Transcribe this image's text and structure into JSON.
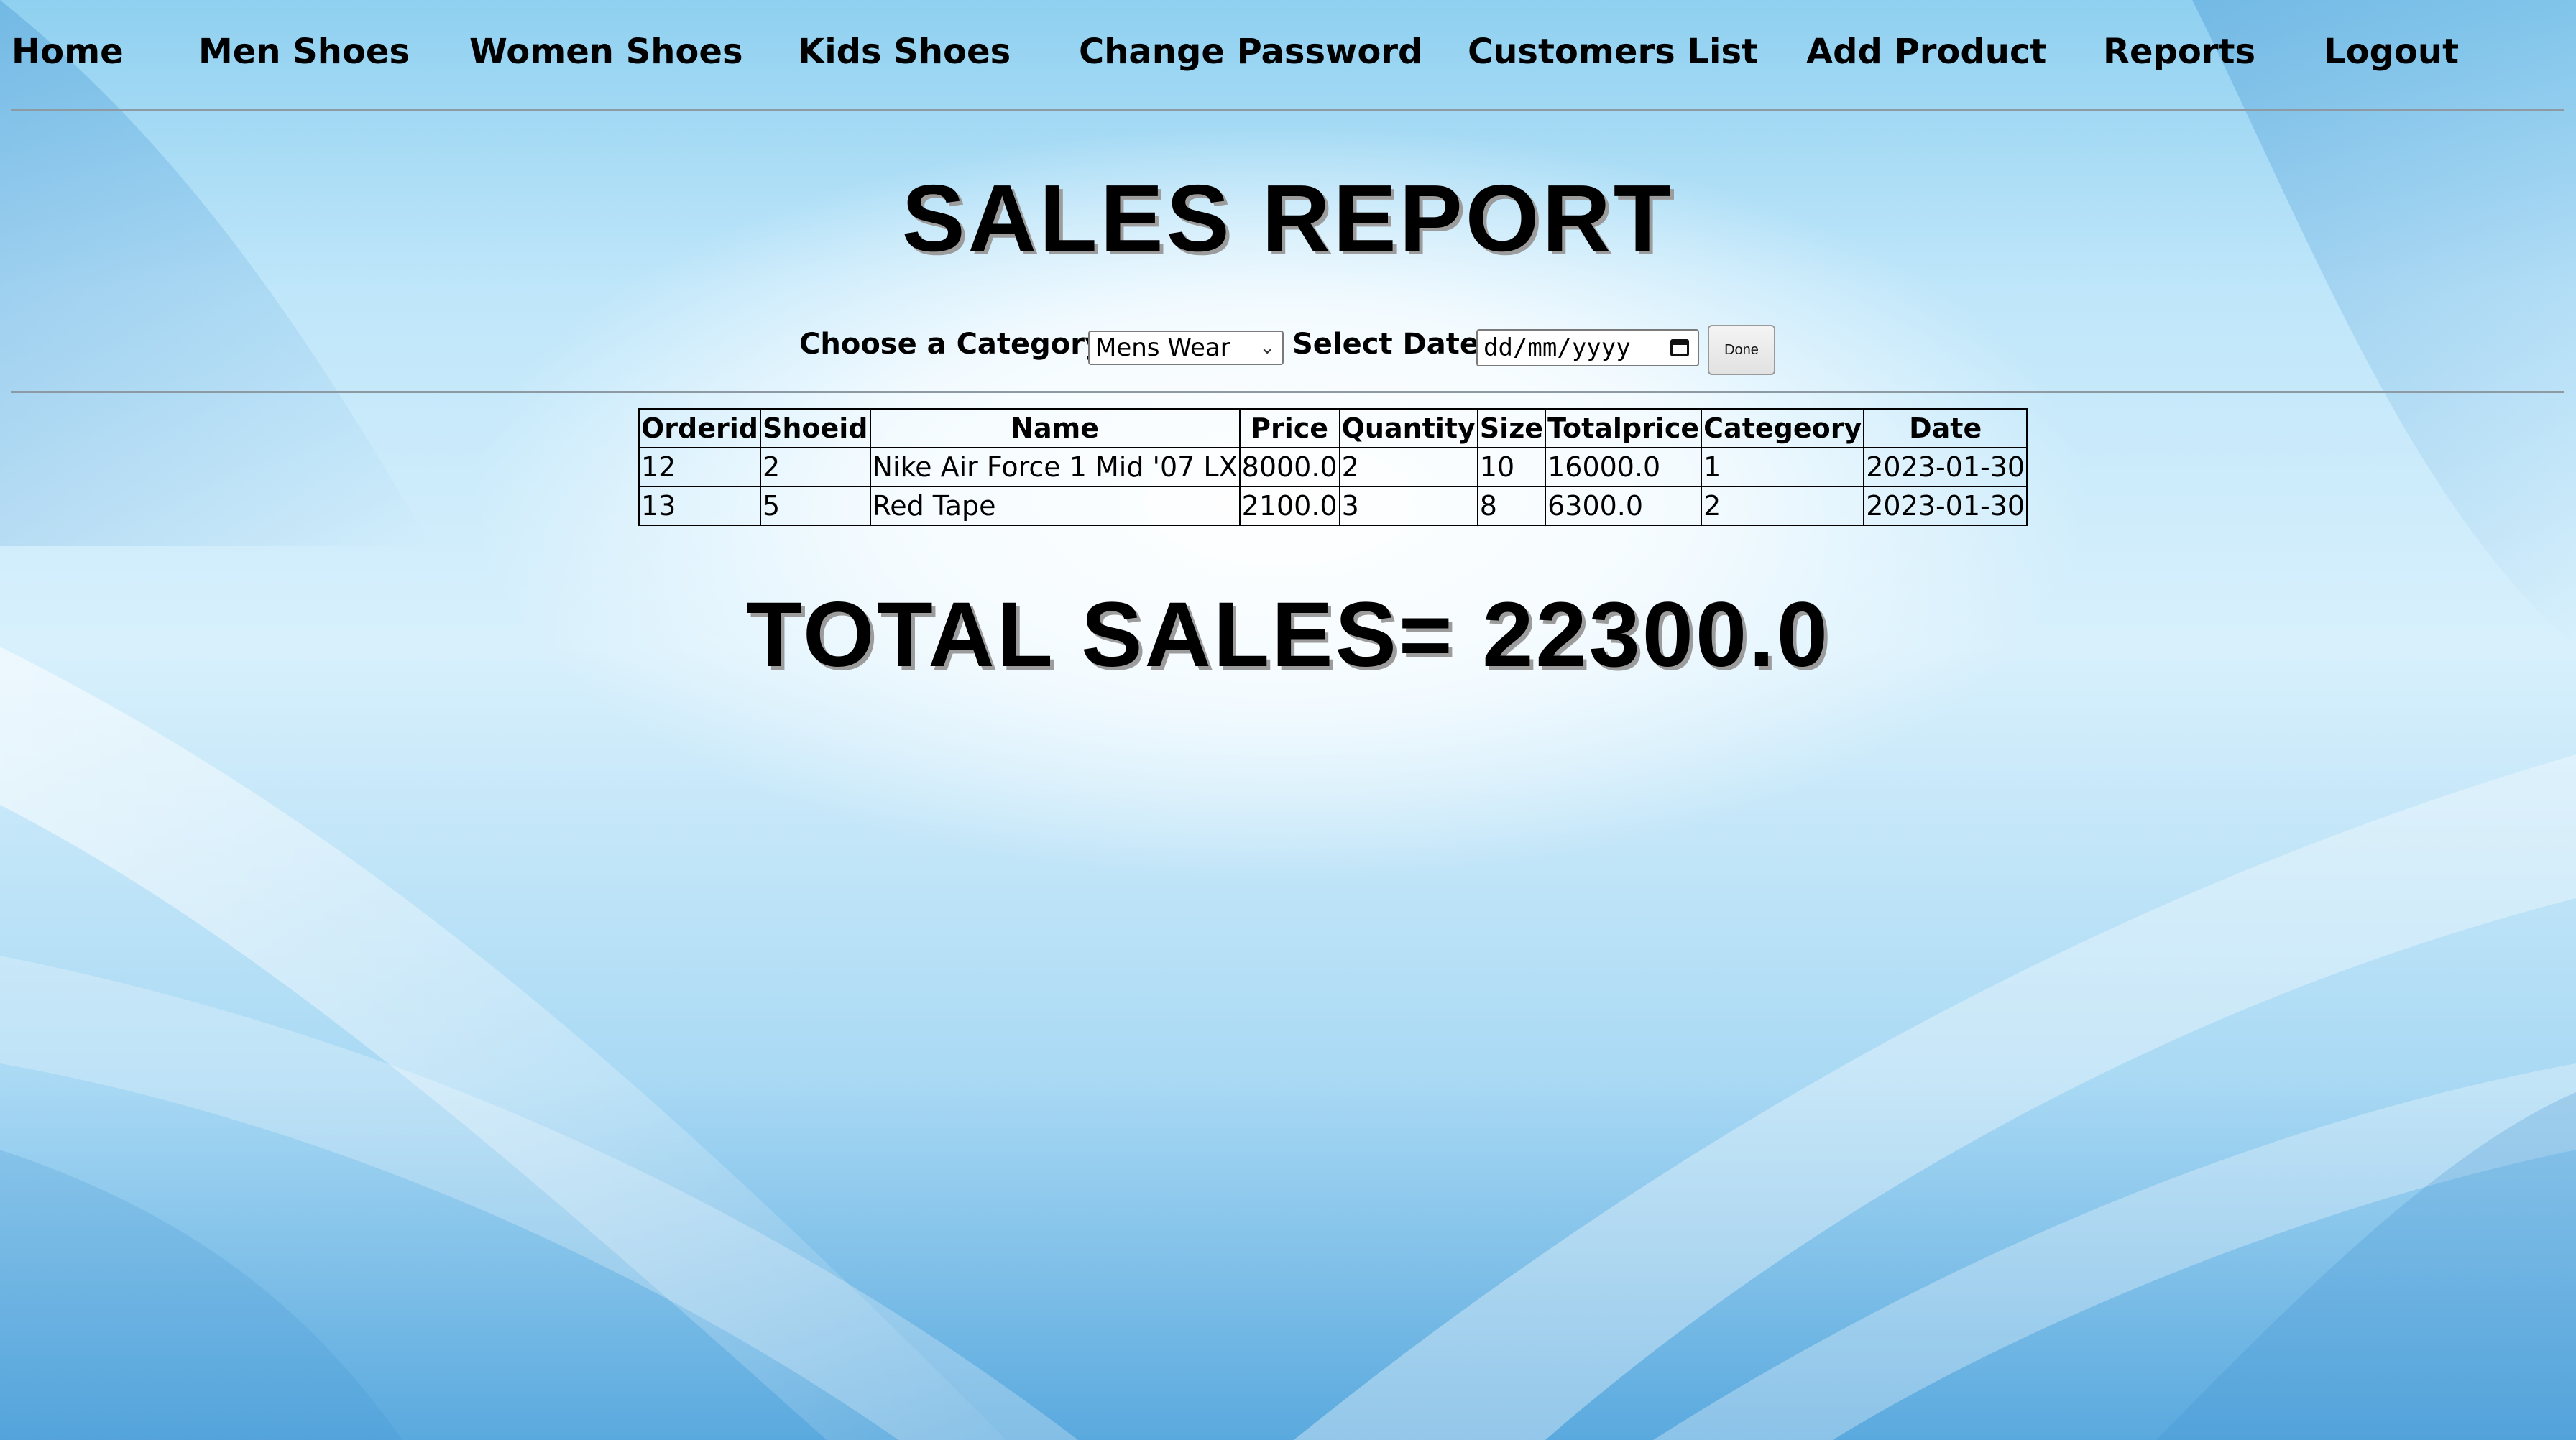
{
  "nav": {
    "items": [
      {
        "label": "Home"
      },
      {
        "label": "Men Shoes"
      },
      {
        "label": "Women Shoes"
      },
      {
        "label": "Kids Shoes"
      },
      {
        "label": "Change Password"
      },
      {
        "label": "Customers List"
      },
      {
        "label": "Add Product"
      },
      {
        "label": "Reports"
      },
      {
        "label": "Logout"
      }
    ]
  },
  "page": {
    "title": "SALES REPORT"
  },
  "filters": {
    "category_label": "Choose a Category:",
    "category_value": "Mens Wear",
    "date_label": "Select Date:",
    "date_placeholder": "dd/mm/yyyy",
    "done_label": "Done"
  },
  "table": {
    "headers": [
      "Orderid",
      "Shoeid",
      "Name",
      "Price",
      "Quantity",
      "Size",
      "Totalprice",
      "Categeory",
      "Date"
    ],
    "rows": [
      [
        "12",
        "2",
        "Nike Air Force 1 Mid '07 LX",
        "8000.0",
        "2",
        "10",
        "16000.0",
        "1",
        "2023-01-30"
      ],
      [
        "13",
        "5",
        "Red Tape",
        "2100.0",
        "3",
        "8",
        "6300.0",
        "2",
        "2023-01-30"
      ]
    ]
  },
  "summary": {
    "total_text": "TOTAL SALES= 22300.0"
  },
  "colors": {
    "background_light": "#f4fbff",
    "background_blue": "#5aa9de",
    "divider": "#8d9aa3",
    "text": "#000000",
    "title_shadow": "#9c9c9c"
  }
}
